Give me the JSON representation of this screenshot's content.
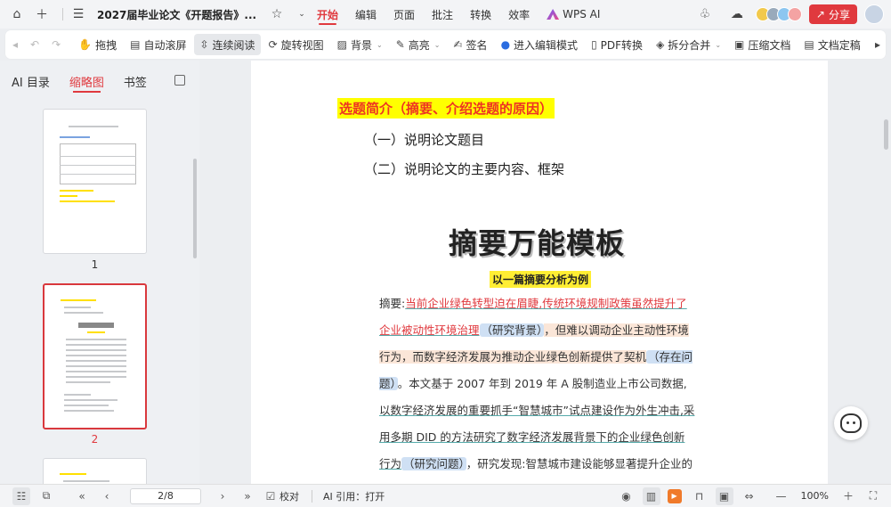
{
  "titlebar": {
    "doc_title": "2027届毕业论文《开题报告》...",
    "menu": [
      "开始",
      "编辑",
      "页面",
      "批注",
      "转换",
      "效率"
    ],
    "wps_ai": "WPS AI",
    "share": "分享"
  },
  "toolbar": {
    "items": [
      {
        "label": "拖拽",
        "icon": "hand-icon"
      },
      {
        "label": "自动滚屏",
        "icon": "auto-scroll-icon"
      },
      {
        "label": "连续阅读",
        "icon": "continuous-read-icon"
      },
      {
        "label": "旋转视图",
        "icon": "rotate-icon"
      },
      {
        "label": "背景",
        "icon": "background-icon"
      },
      {
        "label": "高亮",
        "icon": "highlight-icon"
      },
      {
        "label": "签名",
        "icon": "sign-icon"
      },
      {
        "label": "进入编辑模式",
        "icon": "edit-mode-icon"
      },
      {
        "label": "PDF转换",
        "icon": "pdf-convert-icon"
      },
      {
        "label": "拆分合并",
        "icon": "split-merge-icon"
      },
      {
        "label": "压缩文档",
        "icon": "compress-icon"
      },
      {
        "label": "文档定稿",
        "icon": "finalize-icon"
      }
    ]
  },
  "sidebar": {
    "tabs": [
      "AI 目录",
      "缩略图",
      "书签"
    ],
    "active_tab": "缩略图",
    "thumb_numbers": [
      "1",
      "2"
    ]
  },
  "document": {
    "section_title": "选题简介（摘要、介绍选题的原因）",
    "sub1": "（一）说明论文题目",
    "sub2": "（二）说明论文的主要内容、框架",
    "image_title": "摘要万能模板",
    "image_subtitle": "以一篇摘要分析为例",
    "para": {
      "p1": "摘要:",
      "p2": "当前企业绿色转型迫在眉睫,传统环境规制政策虽然提升了企业被动性环境治理",
      "p3": "（研究背景）",
      "p4": "，但难以调动企业主动性环境行为，而数字经济发展为推动企业绿色创新提供了契机",
      "p5": "（存在问题）",
      "p6": "。本文基于 2007 年到 2019 年 A 股制造业上市公司数据,",
      "p7": "以数字经济发展的重要抓手“智慧城市”试点建设作为外生冲击,采用多期 DID 的方法研究了数字经济发展背景下的企业绿色创新行为",
      "p8": "（研究问题）",
      "p9": "，研究发现:智慧城市建设能够显著提升企业的绿色创新水平，且该结论在经过一系列稳健性检验"
    }
  },
  "statusbar": {
    "page": "2/8",
    "proofread": "校对",
    "ai_ref": "AI 引用：打开",
    "zoom": "100%"
  },
  "colors": {
    "accent": "#e0393e",
    "highlight_yellow": "#ffff00"
  }
}
